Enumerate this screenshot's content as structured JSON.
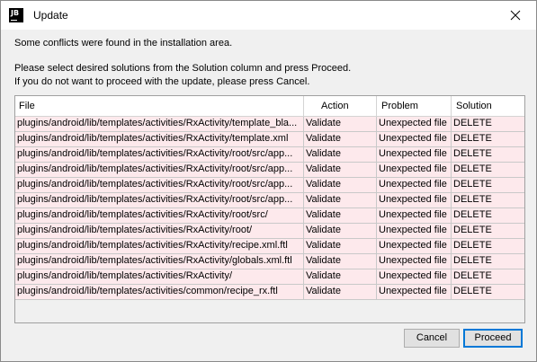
{
  "window": {
    "title": "Update",
    "app_icon_text": "JB"
  },
  "messages": {
    "line1": "Some conflicts were found in the installation area.",
    "line2": "Please select desired solutions from the Solution column and press Proceed.",
    "line3": "If you do not want to proceed with the update, please press Cancel."
  },
  "table": {
    "columns": [
      "File",
      "Action",
      "Problem",
      "Solution"
    ],
    "rows": [
      {
        "file": "plugins/android/lib/templates/activities/RxActivity/template_bla...",
        "action": "Validate",
        "problem": "Unexpected file",
        "solution": "DELETE"
      },
      {
        "file": "plugins/android/lib/templates/activities/RxActivity/template.xml",
        "action": "Validate",
        "problem": "Unexpected file",
        "solution": "DELETE"
      },
      {
        "file": "plugins/android/lib/templates/activities/RxActivity/root/src/app...",
        "action": "Validate",
        "problem": "Unexpected file",
        "solution": "DELETE"
      },
      {
        "file": "plugins/android/lib/templates/activities/RxActivity/root/src/app...",
        "action": "Validate",
        "problem": "Unexpected file",
        "solution": "DELETE"
      },
      {
        "file": "plugins/android/lib/templates/activities/RxActivity/root/src/app...",
        "action": "Validate",
        "problem": "Unexpected file",
        "solution": "DELETE"
      },
      {
        "file": "plugins/android/lib/templates/activities/RxActivity/root/src/app...",
        "action": "Validate",
        "problem": "Unexpected file",
        "solution": "DELETE"
      },
      {
        "file": "plugins/android/lib/templates/activities/RxActivity/root/src/",
        "action": "Validate",
        "problem": "Unexpected file",
        "solution": "DELETE"
      },
      {
        "file": "plugins/android/lib/templates/activities/RxActivity/root/",
        "action": "Validate",
        "problem": "Unexpected file",
        "solution": "DELETE"
      },
      {
        "file": "plugins/android/lib/templates/activities/RxActivity/recipe.xml.ftl",
        "action": "Validate",
        "problem": "Unexpected file",
        "solution": "DELETE"
      },
      {
        "file": "plugins/android/lib/templates/activities/RxActivity/globals.xml.ftl",
        "action": "Validate",
        "problem": "Unexpected file",
        "solution": "DELETE"
      },
      {
        "file": "plugins/android/lib/templates/activities/RxActivity/",
        "action": "Validate",
        "problem": "Unexpected file",
        "solution": "DELETE"
      },
      {
        "file": "plugins/android/lib/templates/activities/common/recipe_rx.ftl",
        "action": "Validate",
        "problem": "Unexpected file",
        "solution": "DELETE"
      }
    ]
  },
  "buttons": {
    "cancel": "Cancel",
    "proceed": "Proceed"
  },
  "colors": {
    "row_background": "#fde9ec",
    "dialog_background": "#f0f0f0",
    "default_button_border": "#0078d7"
  },
  "icons": {
    "app": "jetbrains-logo-icon",
    "close": "close-icon"
  }
}
